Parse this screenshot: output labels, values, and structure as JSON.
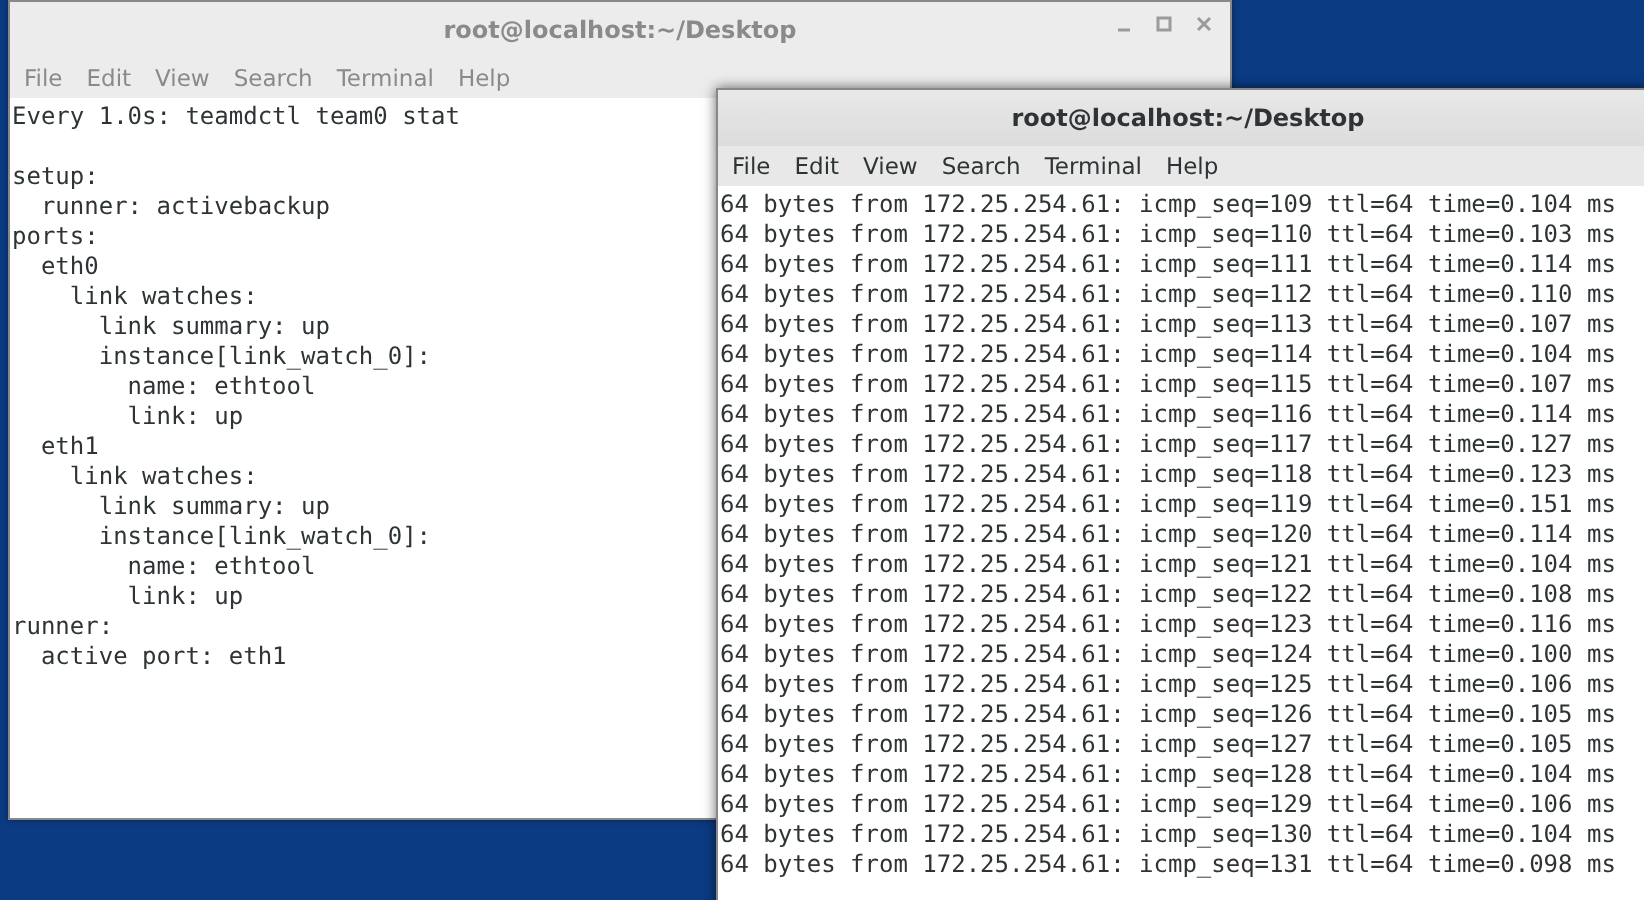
{
  "windows": [
    {
      "title": "root@localhost:~/Desktop",
      "active": false,
      "controls": true,
      "menu": [
        "File",
        "Edit",
        "View",
        "Search",
        "Terminal",
        "Help"
      ],
      "header": "Every 1.0s: teamdctl team0 stat",
      "lines": [
        "setup:",
        "  runner: activebackup",
        "ports:",
        "  eth0",
        "    link watches:",
        "      link summary: up",
        "      instance[link_watch_0]:",
        "        name: ethtool",
        "        link: up",
        "  eth1",
        "    link watches:",
        "      link summary: up",
        "      instance[link_watch_0]:",
        "        name: ethtool",
        "        link: up",
        "runner:",
        "  active port: eth1"
      ]
    },
    {
      "title": "root@localhost:~/Desktop",
      "active": true,
      "controls": false,
      "menu": [
        "File",
        "Edit",
        "View",
        "Search",
        "Terminal",
        "Help"
      ],
      "lines": [
        "64 bytes from 172.25.254.61: icmp_seq=109 ttl=64 time=0.104 ms",
        "64 bytes from 172.25.254.61: icmp_seq=110 ttl=64 time=0.103 ms",
        "64 bytes from 172.25.254.61: icmp_seq=111 ttl=64 time=0.114 ms",
        "64 bytes from 172.25.254.61: icmp_seq=112 ttl=64 time=0.110 ms",
        "64 bytes from 172.25.254.61: icmp_seq=113 ttl=64 time=0.107 ms",
        "64 bytes from 172.25.254.61: icmp_seq=114 ttl=64 time=0.104 ms",
        "64 bytes from 172.25.254.61: icmp_seq=115 ttl=64 time=0.107 ms",
        "64 bytes from 172.25.254.61: icmp_seq=116 ttl=64 time=0.114 ms",
        "64 bytes from 172.25.254.61: icmp_seq=117 ttl=64 time=0.127 ms",
        "64 bytes from 172.25.254.61: icmp_seq=118 ttl=64 time=0.123 ms",
        "64 bytes from 172.25.254.61: icmp_seq=119 ttl=64 time=0.151 ms",
        "64 bytes from 172.25.254.61: icmp_seq=120 ttl=64 time=0.114 ms",
        "64 bytes from 172.25.254.61: icmp_seq=121 ttl=64 time=0.104 ms",
        "64 bytes from 172.25.254.61: icmp_seq=122 ttl=64 time=0.108 ms",
        "64 bytes from 172.25.254.61: icmp_seq=123 ttl=64 time=0.116 ms",
        "64 bytes from 172.25.254.61: icmp_seq=124 ttl=64 time=0.100 ms",
        "64 bytes from 172.25.254.61: icmp_seq=125 ttl=64 time=0.106 ms",
        "64 bytes from 172.25.254.61: icmp_seq=126 ttl=64 time=0.105 ms",
        "64 bytes from 172.25.254.61: icmp_seq=127 ttl=64 time=0.105 ms",
        "64 bytes from 172.25.254.61: icmp_seq=128 ttl=64 time=0.104 ms",
        "64 bytes from 172.25.254.61: icmp_seq=129 ttl=64 time=0.106 ms",
        "64 bytes from 172.25.254.61: icmp_seq=130 ttl=64 time=0.104 ms",
        "64 bytes from 172.25.254.61: icmp_seq=131 ttl=64 time=0.098 ms"
      ]
    }
  ]
}
